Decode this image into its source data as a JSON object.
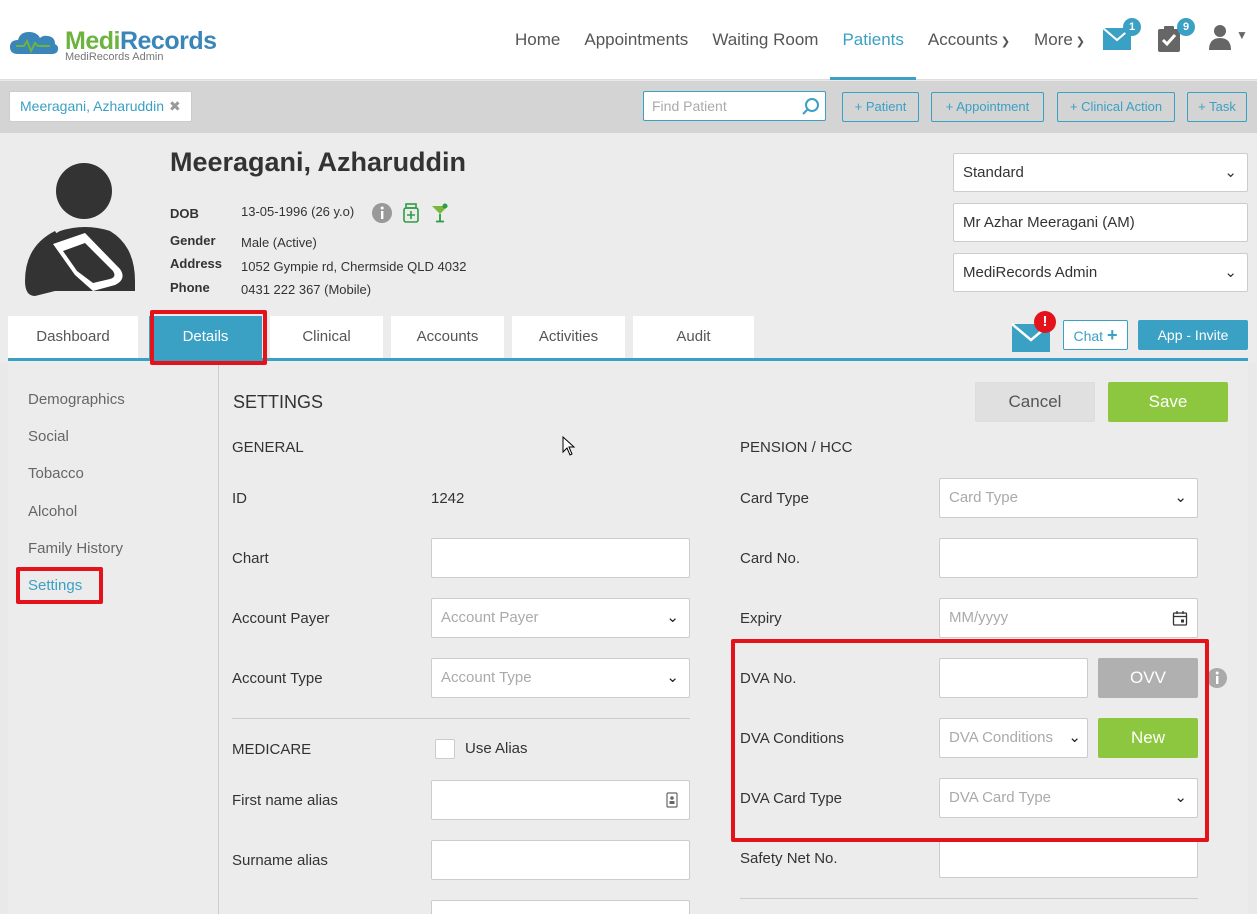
{
  "brand": {
    "name_part1": "Medi",
    "name_part2": "Records",
    "subtitle": "MediRecords Admin"
  },
  "nav": {
    "items": [
      "Home",
      "Appointments",
      "Waiting Room",
      "Patients",
      "Accounts",
      "More"
    ],
    "active": "Patients",
    "messages_badge": "1",
    "tasks_badge": "9"
  },
  "patient_bar": {
    "open_tab": "Meeragani, Azharuddin",
    "find_placeholder": "Find Patient",
    "quick_actions": [
      "+ Patient",
      "+ Appointment",
      "+ Clinical Action",
      "+ Task"
    ]
  },
  "patient": {
    "name": "Meeragani, Azharuddin",
    "labels": [
      "DOB",
      "Gender",
      "Address",
      "Phone"
    ],
    "dob": "13-05-1996 (26 y.o)",
    "gender": "Male (Active)",
    "address": "1052 Gympie rd, Chermside QLD 4032",
    "phone": "0431 222 367 (Mobile)"
  },
  "header_selects": {
    "type": "Standard",
    "provider": "Mr Azhar Meeragani (AM)",
    "practice": "MediRecords Admin"
  },
  "tabs": [
    "Dashboard",
    "Details",
    "Clinical",
    "Accounts",
    "Activities",
    "Audit"
  ],
  "active_tab": "Details",
  "header_actions": {
    "chat": "Chat",
    "app_invite": "App - Invite"
  },
  "sidenav": [
    "Demographics",
    "Social",
    "Tobacco",
    "Alcohol",
    "Family History",
    "Settings"
  ],
  "sidenav_active": "Settings",
  "settings": {
    "title": "SETTINGS",
    "cancel": "Cancel",
    "save": "Save",
    "general": {
      "heading": "GENERAL",
      "id_label": "ID",
      "id_value": "1242",
      "chart_label": "Chart",
      "account_payer_label": "Account Payer",
      "account_payer_placeholder": "Account Payer",
      "account_type_label": "Account Type",
      "account_type_placeholder": "Account Type"
    },
    "medicare": {
      "heading": "MEDICARE",
      "use_alias": "Use Alias",
      "first_name_alias": "First name alias",
      "surname_alias": "Surname alias"
    },
    "pension": {
      "heading": "PENSION / HCC",
      "card_type_label": "Card Type",
      "card_type_placeholder": "Card Type",
      "card_no_label": "Card No.",
      "expiry_label": "Expiry",
      "expiry_placeholder": "MM/yyyy",
      "dva_no_label": "DVA No.",
      "ovv": "OVV",
      "dva_conditions_label": "DVA Conditions",
      "dva_conditions_placeholder": "DVA Conditions",
      "new": "New",
      "dva_card_type_label": "DVA Card Type",
      "dva_card_type_placeholder": "DVA Card Type",
      "safety_net_label": "Safety Net No."
    }
  },
  "colors": {
    "accent": "#3aa0c4",
    "green": "#8dc63f",
    "highlight": "#e3121b"
  }
}
